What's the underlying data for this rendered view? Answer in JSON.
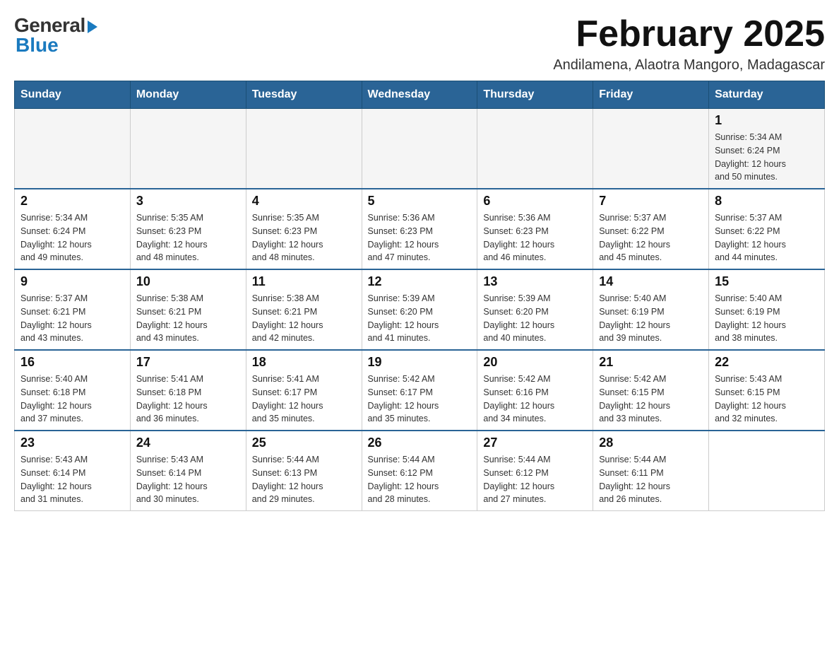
{
  "header": {
    "logo_general": "General",
    "logo_blue": "Blue",
    "title": "February 2025",
    "location": "Andilamena, Alaotra Mangoro, Madagascar"
  },
  "weekdays": [
    "Sunday",
    "Monday",
    "Tuesday",
    "Wednesday",
    "Thursday",
    "Friday",
    "Saturday"
  ],
  "weeks": [
    [
      {
        "day": "",
        "info": ""
      },
      {
        "day": "",
        "info": ""
      },
      {
        "day": "",
        "info": ""
      },
      {
        "day": "",
        "info": ""
      },
      {
        "day": "",
        "info": ""
      },
      {
        "day": "",
        "info": ""
      },
      {
        "day": "1",
        "info": "Sunrise: 5:34 AM\nSunset: 6:24 PM\nDaylight: 12 hours\nand 50 minutes."
      }
    ],
    [
      {
        "day": "2",
        "info": "Sunrise: 5:34 AM\nSunset: 6:24 PM\nDaylight: 12 hours\nand 49 minutes."
      },
      {
        "day": "3",
        "info": "Sunrise: 5:35 AM\nSunset: 6:23 PM\nDaylight: 12 hours\nand 48 minutes."
      },
      {
        "day": "4",
        "info": "Sunrise: 5:35 AM\nSunset: 6:23 PM\nDaylight: 12 hours\nand 48 minutes."
      },
      {
        "day": "5",
        "info": "Sunrise: 5:36 AM\nSunset: 6:23 PM\nDaylight: 12 hours\nand 47 minutes."
      },
      {
        "day": "6",
        "info": "Sunrise: 5:36 AM\nSunset: 6:23 PM\nDaylight: 12 hours\nand 46 minutes."
      },
      {
        "day": "7",
        "info": "Sunrise: 5:37 AM\nSunset: 6:22 PM\nDaylight: 12 hours\nand 45 minutes."
      },
      {
        "day": "8",
        "info": "Sunrise: 5:37 AM\nSunset: 6:22 PM\nDaylight: 12 hours\nand 44 minutes."
      }
    ],
    [
      {
        "day": "9",
        "info": "Sunrise: 5:37 AM\nSunset: 6:21 PM\nDaylight: 12 hours\nand 43 minutes."
      },
      {
        "day": "10",
        "info": "Sunrise: 5:38 AM\nSunset: 6:21 PM\nDaylight: 12 hours\nand 43 minutes."
      },
      {
        "day": "11",
        "info": "Sunrise: 5:38 AM\nSunset: 6:21 PM\nDaylight: 12 hours\nand 42 minutes."
      },
      {
        "day": "12",
        "info": "Sunrise: 5:39 AM\nSunset: 6:20 PM\nDaylight: 12 hours\nand 41 minutes."
      },
      {
        "day": "13",
        "info": "Sunrise: 5:39 AM\nSunset: 6:20 PM\nDaylight: 12 hours\nand 40 minutes."
      },
      {
        "day": "14",
        "info": "Sunrise: 5:40 AM\nSunset: 6:19 PM\nDaylight: 12 hours\nand 39 minutes."
      },
      {
        "day": "15",
        "info": "Sunrise: 5:40 AM\nSunset: 6:19 PM\nDaylight: 12 hours\nand 38 minutes."
      }
    ],
    [
      {
        "day": "16",
        "info": "Sunrise: 5:40 AM\nSunset: 6:18 PM\nDaylight: 12 hours\nand 37 minutes."
      },
      {
        "day": "17",
        "info": "Sunrise: 5:41 AM\nSunset: 6:18 PM\nDaylight: 12 hours\nand 36 minutes."
      },
      {
        "day": "18",
        "info": "Sunrise: 5:41 AM\nSunset: 6:17 PM\nDaylight: 12 hours\nand 35 minutes."
      },
      {
        "day": "19",
        "info": "Sunrise: 5:42 AM\nSunset: 6:17 PM\nDaylight: 12 hours\nand 35 minutes."
      },
      {
        "day": "20",
        "info": "Sunrise: 5:42 AM\nSunset: 6:16 PM\nDaylight: 12 hours\nand 34 minutes."
      },
      {
        "day": "21",
        "info": "Sunrise: 5:42 AM\nSunset: 6:15 PM\nDaylight: 12 hours\nand 33 minutes."
      },
      {
        "day": "22",
        "info": "Sunrise: 5:43 AM\nSunset: 6:15 PM\nDaylight: 12 hours\nand 32 minutes."
      }
    ],
    [
      {
        "day": "23",
        "info": "Sunrise: 5:43 AM\nSunset: 6:14 PM\nDaylight: 12 hours\nand 31 minutes."
      },
      {
        "day": "24",
        "info": "Sunrise: 5:43 AM\nSunset: 6:14 PM\nDaylight: 12 hours\nand 30 minutes."
      },
      {
        "day": "25",
        "info": "Sunrise: 5:44 AM\nSunset: 6:13 PM\nDaylight: 12 hours\nand 29 minutes."
      },
      {
        "day": "26",
        "info": "Sunrise: 5:44 AM\nSunset: 6:12 PM\nDaylight: 12 hours\nand 28 minutes."
      },
      {
        "day": "27",
        "info": "Sunrise: 5:44 AM\nSunset: 6:12 PM\nDaylight: 12 hours\nand 27 minutes."
      },
      {
        "day": "28",
        "info": "Sunrise: 5:44 AM\nSunset: 6:11 PM\nDaylight: 12 hours\nand 26 minutes."
      },
      {
        "day": "",
        "info": ""
      }
    ]
  ]
}
